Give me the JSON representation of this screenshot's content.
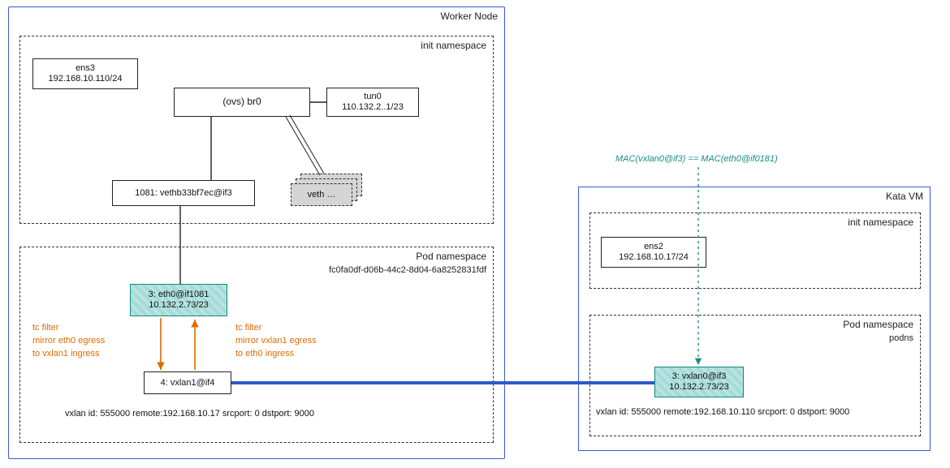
{
  "worker": {
    "title": "Worker Node",
    "init_ns": {
      "title": "init namespace",
      "ens3": {
        "name": "ens3",
        "ip": "192.168.10.110/24"
      },
      "br0": {
        "name": "(ovs) br0"
      },
      "tun0": {
        "name": "tun0",
        "ip": "110.132.2..1/23"
      },
      "vethpair": {
        "name": "1081: vethb33bf7ec@if3"
      },
      "veth_stack": "veth …"
    },
    "pod_ns": {
      "title": "Pod namespace",
      "id": "fc0fa0df-d06b-44c2-8d04-6a8252831fdf",
      "eth0": {
        "line1": "3: eth0@if1081",
        "line2": "10.132.2.73/23"
      },
      "vxlan": {
        "name": "4: vxlan1@if4"
      },
      "vxlan_details": "vxlan id: 555000 remote:192.168.10.17 srcport: 0 dstport: 9000",
      "tc_left": {
        "l1": "tc filter",
        "l2": "mirror eth0 egress",
        "l3": "to vxlan1 ingress"
      },
      "tc_right": {
        "l1": "tc filter",
        "l2": "mirror vxlan1 egress",
        "l3": "to eth0 ingress"
      }
    }
  },
  "kata": {
    "title": "Kata VM",
    "init_ns": {
      "title": "init namespace",
      "ens2": {
        "name": "ens2",
        "ip": "192.168.10.17/24"
      }
    },
    "pod_ns": {
      "title": "Pod namespace",
      "subtitle": "podns",
      "vxlan0": {
        "line1": "3: vxlan0@if3",
        "line2": "10.132.2.73/23"
      },
      "vxlan_details": "vxlan id: 555000 remote:192.168.10.110 srcport: 0 dstport: 9000"
    }
  },
  "mac_note": "MAC(vxlan0@if3) == MAC(eth0@if0181)"
}
